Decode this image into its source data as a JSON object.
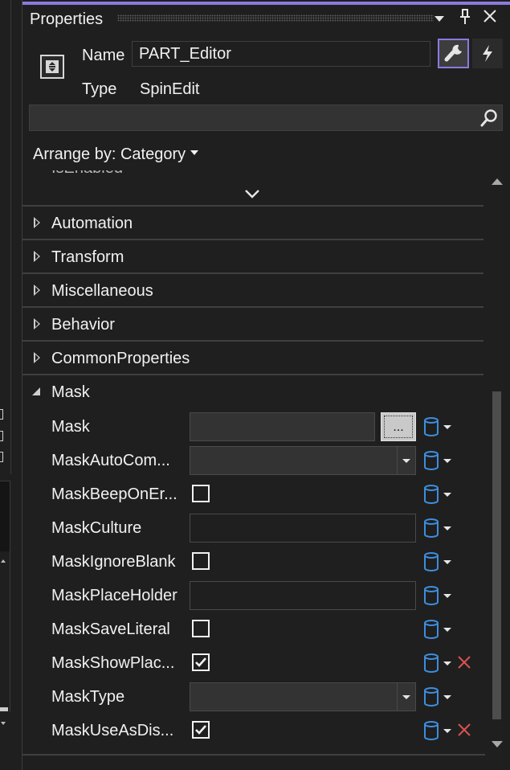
{
  "window": {
    "title": "Properties",
    "accent_color": "#8b7ae0",
    "buttons": [
      "dropdown",
      "pin",
      "close"
    ]
  },
  "header": {
    "name_label": "Name",
    "name_value": "PART_Editor",
    "type_label": "Type",
    "type_value": "SpinEdit",
    "search_placeholder": ""
  },
  "arrange": {
    "label": "Arrange by: Category"
  },
  "partial_row": {
    "label": "IsEnabled"
  },
  "categories": [
    {
      "label": "Automation",
      "expanded": false
    },
    {
      "label": "Transform",
      "expanded": false
    },
    {
      "label": "Miscellaneous",
      "expanded": false
    },
    {
      "label": "Behavior",
      "expanded": false
    },
    {
      "label": "CommonProperties",
      "expanded": false
    },
    {
      "label": "Mask",
      "expanded": true
    }
  ],
  "mask_properties": [
    {
      "label": "Mask",
      "editor": "text-ellipsis",
      "value": "",
      "ellipsis": "...",
      "clear": false
    },
    {
      "label": "MaskAutoCom...",
      "editor": "combo",
      "value": "",
      "clear": false
    },
    {
      "label": "MaskBeepOnEr...",
      "editor": "checkbox",
      "checked": false,
      "clear": false
    },
    {
      "label": "MaskCulture",
      "editor": "text",
      "value": "",
      "clear": false
    },
    {
      "label": "MaskIgnoreBlank",
      "editor": "checkbox",
      "checked": false,
      "clear": false
    },
    {
      "label": "MaskPlaceHolder",
      "editor": "text",
      "value": "",
      "clear": false
    },
    {
      "label": "MaskSaveLiteral",
      "editor": "checkbox",
      "checked": false,
      "clear": false
    },
    {
      "label": "MaskShowPlac...",
      "editor": "checkbox",
      "checked": true,
      "clear": true
    },
    {
      "label": "MaskType",
      "editor": "combo",
      "value": "",
      "clear": false
    },
    {
      "label": "MaskUseAsDis...",
      "editor": "checkbox",
      "checked": true,
      "clear": true
    }
  ],
  "colors": {
    "background": "#1f1f1f",
    "binding_icon": "#3d8ee0",
    "clear_icon": "#d9534f"
  }
}
